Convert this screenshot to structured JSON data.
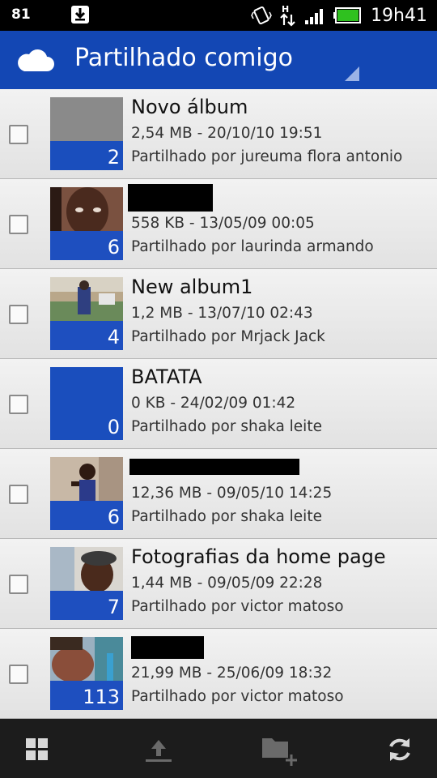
{
  "status_bar": {
    "notification_count": "81",
    "time": "19h41",
    "icons": [
      "download-icon",
      "vibrate-icon",
      "data-transfer-icon",
      "signal-icon",
      "battery-icon"
    ]
  },
  "action_bar": {
    "title": "Partilhado comigo",
    "icon": "cloud-icon",
    "accent_color": "#1347b4"
  },
  "albums": [
    {
      "title": "Novo álbum",
      "redacted": false,
      "meta": "2,54 MB - 20/10/10 19:51",
      "shared_by": "Partilhado por jureuma flora antonio",
      "count": "2",
      "thumb": "gray"
    },
    {
      "title": "",
      "redacted": true,
      "meta": "558 KB - 13/05/09 00:05",
      "shared_by": "Partilhado por laurinda armando",
      "count": "6",
      "thumb": "face"
    },
    {
      "title": "New album1",
      "redacted": false,
      "meta": "1,2 MB - 13/07/10 02:43",
      "shared_by": "Partilhado por Mrjack Jack",
      "count": "4",
      "thumb": "outdoor"
    },
    {
      "title": "BATATA",
      "redacted": false,
      "meta": "0 KB - 24/02/09 01:42",
      "shared_by": "Partilhado por shaka leite",
      "count": "0",
      "thumb": "empty"
    },
    {
      "title": "",
      "redacted": true,
      "meta": "12,36 MB - 09/05/10 14:25",
      "shared_by": "Partilhado por shaka leite",
      "count": "6",
      "thumb": "person"
    },
    {
      "title": "Fotografias da home page",
      "redacted": false,
      "meta": "1,44 MB - 09/05/09 22:28",
      "shared_by": "Partilhado por victor matoso",
      "count": "7",
      "thumb": "cap"
    },
    {
      "title": "",
      "redacted": true,
      "meta": "21,99 MB - 25/06/09 18:32",
      "shared_by": "Partilhado por victor matoso",
      "count": "113",
      "thumb": "beach"
    }
  ],
  "bottom_bar": {
    "buttons": [
      "grid-view-icon",
      "upload-icon",
      "new-folder-icon",
      "refresh-icon"
    ]
  }
}
